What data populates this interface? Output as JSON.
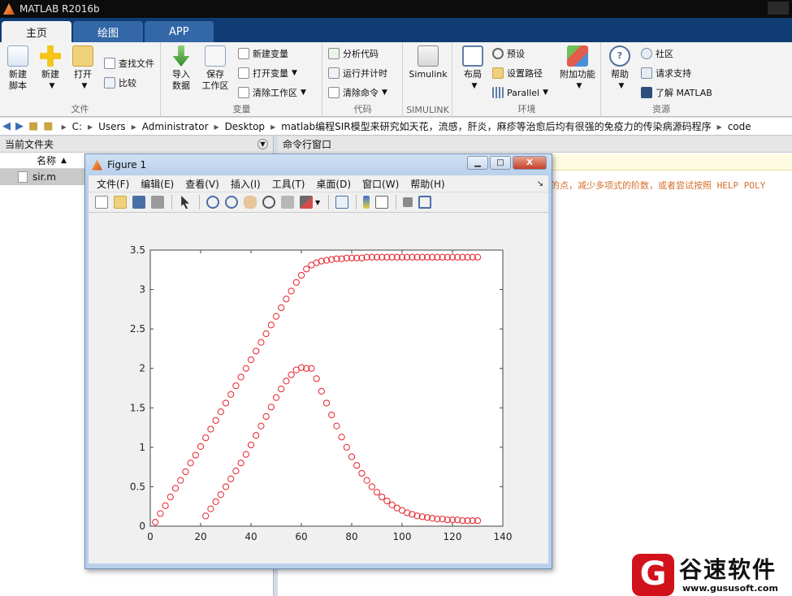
{
  "app": {
    "title": "MATLAB R2016b"
  },
  "tabs": [
    {
      "label": "主页",
      "active": true
    },
    {
      "label": "绘图",
      "active": false
    },
    {
      "label": "APP",
      "active": false
    }
  ],
  "ribbon": {
    "file": {
      "label": "文件",
      "new_script": "新建\n脚本",
      "new": "新建",
      "open": "打开",
      "find_files": "查找文件",
      "compare": "比较"
    },
    "variable": {
      "label": "变量",
      "import": "导入\n数据",
      "save_ws": "保存\n工作区",
      "new_var": "新建变量",
      "open_var": "打开变量",
      "clear_ws": "清除工作区"
    },
    "code": {
      "label": "代码",
      "analyze": "分析代码",
      "run_time": "运行并计时",
      "clear_cmd": "清除命令"
    },
    "simulink": {
      "label": "SIMULINK",
      "button": "Simulink"
    },
    "env": {
      "label": "环境",
      "layout": "布局",
      "prefs": "预设",
      "set_path": "设置路径",
      "parallel": "Parallel",
      "addons": "附加功能"
    },
    "resources": {
      "label": "资源",
      "help": "帮助",
      "community": "社区",
      "support": "请求支持",
      "learn": "了解 MATLAB"
    }
  },
  "address": {
    "parts": [
      "C:",
      "Users",
      "Administrator",
      "Desktop",
      "matlab编程SIR模型来研究如天花，流感，肝炎，麻疹等治愈后均有很强的免疫力的传染病源码程序",
      "code"
    ]
  },
  "current_folder": {
    "title": "当前文件夹",
    "column": "名称",
    "sort": "▲",
    "files": [
      "sir.m"
    ]
  },
  "command_window": {
    "title": "命令行窗口",
    "text": "的点，减少多项式的阶数，或者尝试按照 HELP POLY"
  },
  "figure": {
    "title": "Figure 1",
    "menu": [
      "文件(F)",
      "编辑(E)",
      "查看(V)",
      "插入(I)",
      "工具(T)",
      "桌面(D)",
      "窗口(W)",
      "帮助(H)"
    ],
    "minimize": "▁",
    "maximize": "□",
    "close": "X"
  },
  "chart_data": {
    "type": "scatter",
    "marker": "o",
    "color": "#e8202a",
    "xlim": [
      0,
      140
    ],
    "ylim": [
      0,
      3.5
    ],
    "xticks": [
      0,
      20,
      40,
      60,
      80,
      100,
      120,
      140
    ],
    "yticks": [
      0,
      0.5,
      1,
      1.5,
      2,
      2.5,
      3,
      3.5
    ],
    "series": [
      {
        "x": [
          2,
          4,
          6,
          8,
          10,
          12,
          14,
          16,
          18,
          20,
          22,
          24,
          26,
          28,
          30,
          32,
          34,
          36,
          38,
          40,
          42,
          44,
          46,
          48,
          50,
          52,
          54,
          56,
          58,
          60,
          62,
          64,
          66,
          68,
          70,
          72,
          74,
          76,
          78,
          80,
          82,
          84,
          86,
          88,
          90,
          92,
          94,
          96,
          98,
          100,
          102,
          104,
          106,
          108,
          110,
          112,
          114,
          116,
          118,
          120,
          122,
          124,
          126,
          128,
          130
        ],
        "y": [
          0.05,
          0.16,
          0.26,
          0.37,
          0.48,
          0.58,
          0.69,
          0.8,
          0.9,
          1.01,
          1.12,
          1.23,
          1.34,
          1.45,
          1.56,
          1.67,
          1.78,
          1.89,
          2.0,
          2.11,
          2.22,
          2.33,
          2.44,
          2.55,
          2.66,
          2.77,
          2.88,
          2.98,
          3.09,
          3.18,
          3.26,
          3.31,
          3.34,
          3.36,
          3.37,
          3.38,
          3.39,
          3.39,
          3.4,
          3.4,
          3.4,
          3.4,
          3.41,
          3.41,
          3.41,
          3.41,
          3.41,
          3.41,
          3.41,
          3.41,
          3.41,
          3.41,
          3.41,
          3.41,
          3.41,
          3.41,
          3.41,
          3.41,
          3.41,
          3.41,
          3.41,
          3.41,
          3.41,
          3.41,
          3.41
        ]
      },
      {
        "x": [
          22,
          24,
          26,
          28,
          30,
          32,
          34,
          36,
          38,
          40,
          42,
          44,
          46,
          48,
          50,
          52,
          54,
          56,
          58,
          60,
          62,
          64,
          66,
          68,
          70,
          72,
          74,
          76,
          78,
          80,
          82,
          84,
          86,
          88,
          90,
          92,
          94,
          96,
          98,
          100,
          102,
          104,
          106,
          108,
          110,
          112,
          114,
          116,
          118,
          120,
          122,
          124,
          126,
          128,
          130
        ],
        "y": [
          0.13,
          0.22,
          0.31,
          0.4,
          0.5,
          0.6,
          0.7,
          0.8,
          0.91,
          1.03,
          1.15,
          1.27,
          1.39,
          1.51,
          1.63,
          1.74,
          1.84,
          1.92,
          1.98,
          2.01,
          2.0,
          2.0,
          1.87,
          1.71,
          1.56,
          1.41,
          1.27,
          1.13,
          1.0,
          0.88,
          0.77,
          0.67,
          0.58,
          0.5,
          0.43,
          0.37,
          0.32,
          0.27,
          0.23,
          0.2,
          0.17,
          0.15,
          0.13,
          0.12,
          0.11,
          0.1,
          0.09,
          0.09,
          0.08,
          0.08,
          0.08,
          0.07,
          0.07,
          0.07,
          0.07
        ]
      }
    ]
  },
  "watermark": {
    "logo": "G",
    "text": "谷速软件",
    "url": "www.gususoft.com"
  }
}
